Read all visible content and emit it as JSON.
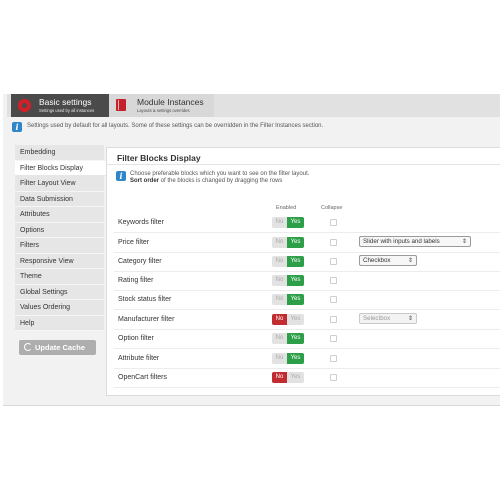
{
  "tabs": [
    {
      "title": "Basic settings",
      "subtitle": "Settings used by all instances",
      "icon": "gear-icon"
    },
    {
      "title": "Module Instances",
      "subtitle": "Layouts & settings overrides",
      "icon": "book-icon"
    }
  ],
  "info_text": "Settings used by default for all layouts. Some of these settings can be overridden in the Filter Instances section.",
  "sidebar": {
    "items": [
      {
        "label": "Embedding"
      },
      {
        "label": "Filter Blocks Display"
      },
      {
        "label": "Filter Layout View"
      },
      {
        "label": "Data Submission"
      },
      {
        "label": "Attributes"
      },
      {
        "label": "Options"
      },
      {
        "label": "Filters"
      },
      {
        "label": "Responsive View"
      },
      {
        "label": "Theme"
      },
      {
        "label": "Global Settings"
      },
      {
        "label": "Values Ordering"
      },
      {
        "label": "Help"
      }
    ],
    "active": "Filter Blocks Display",
    "update_button": "Update Cache"
  },
  "panel": {
    "title": "Filter Blocks Display",
    "desc_line1": "Choose preferable blocks which you want to see on the filter layout.",
    "desc_bold": "Sort order",
    "desc_rest": " of the blocks is changed by dragging the rows",
    "col_enabled": "Enabled",
    "col_collapse": "Collapse",
    "toggle_no": "No",
    "toggle_yes": "Yes",
    "rows": [
      {
        "label": "Keywords filter",
        "enabled": true,
        "select": ""
      },
      {
        "label": "Price filter",
        "enabled": true,
        "select": "Slider with inputs and labels"
      },
      {
        "label": "Category filter",
        "enabled": true,
        "select": "Checkbox"
      },
      {
        "label": "Rating filter",
        "enabled": true,
        "select": ""
      },
      {
        "label": "Stock status filter",
        "enabled": true,
        "select": ""
      },
      {
        "label": "Manufacturer filter",
        "enabled": false,
        "select": "Selectbox"
      },
      {
        "label": "Option filter",
        "enabled": true,
        "select": ""
      },
      {
        "label": "Attribute filter",
        "enabled": true,
        "select": ""
      },
      {
        "label": "OpenCart filters",
        "enabled": false,
        "select": ""
      }
    ]
  },
  "colors": {
    "accent_on": "#2e9f49",
    "accent_off": "#c12c31",
    "info": "#2f86c8",
    "tab_active": "#4a4a4a"
  }
}
